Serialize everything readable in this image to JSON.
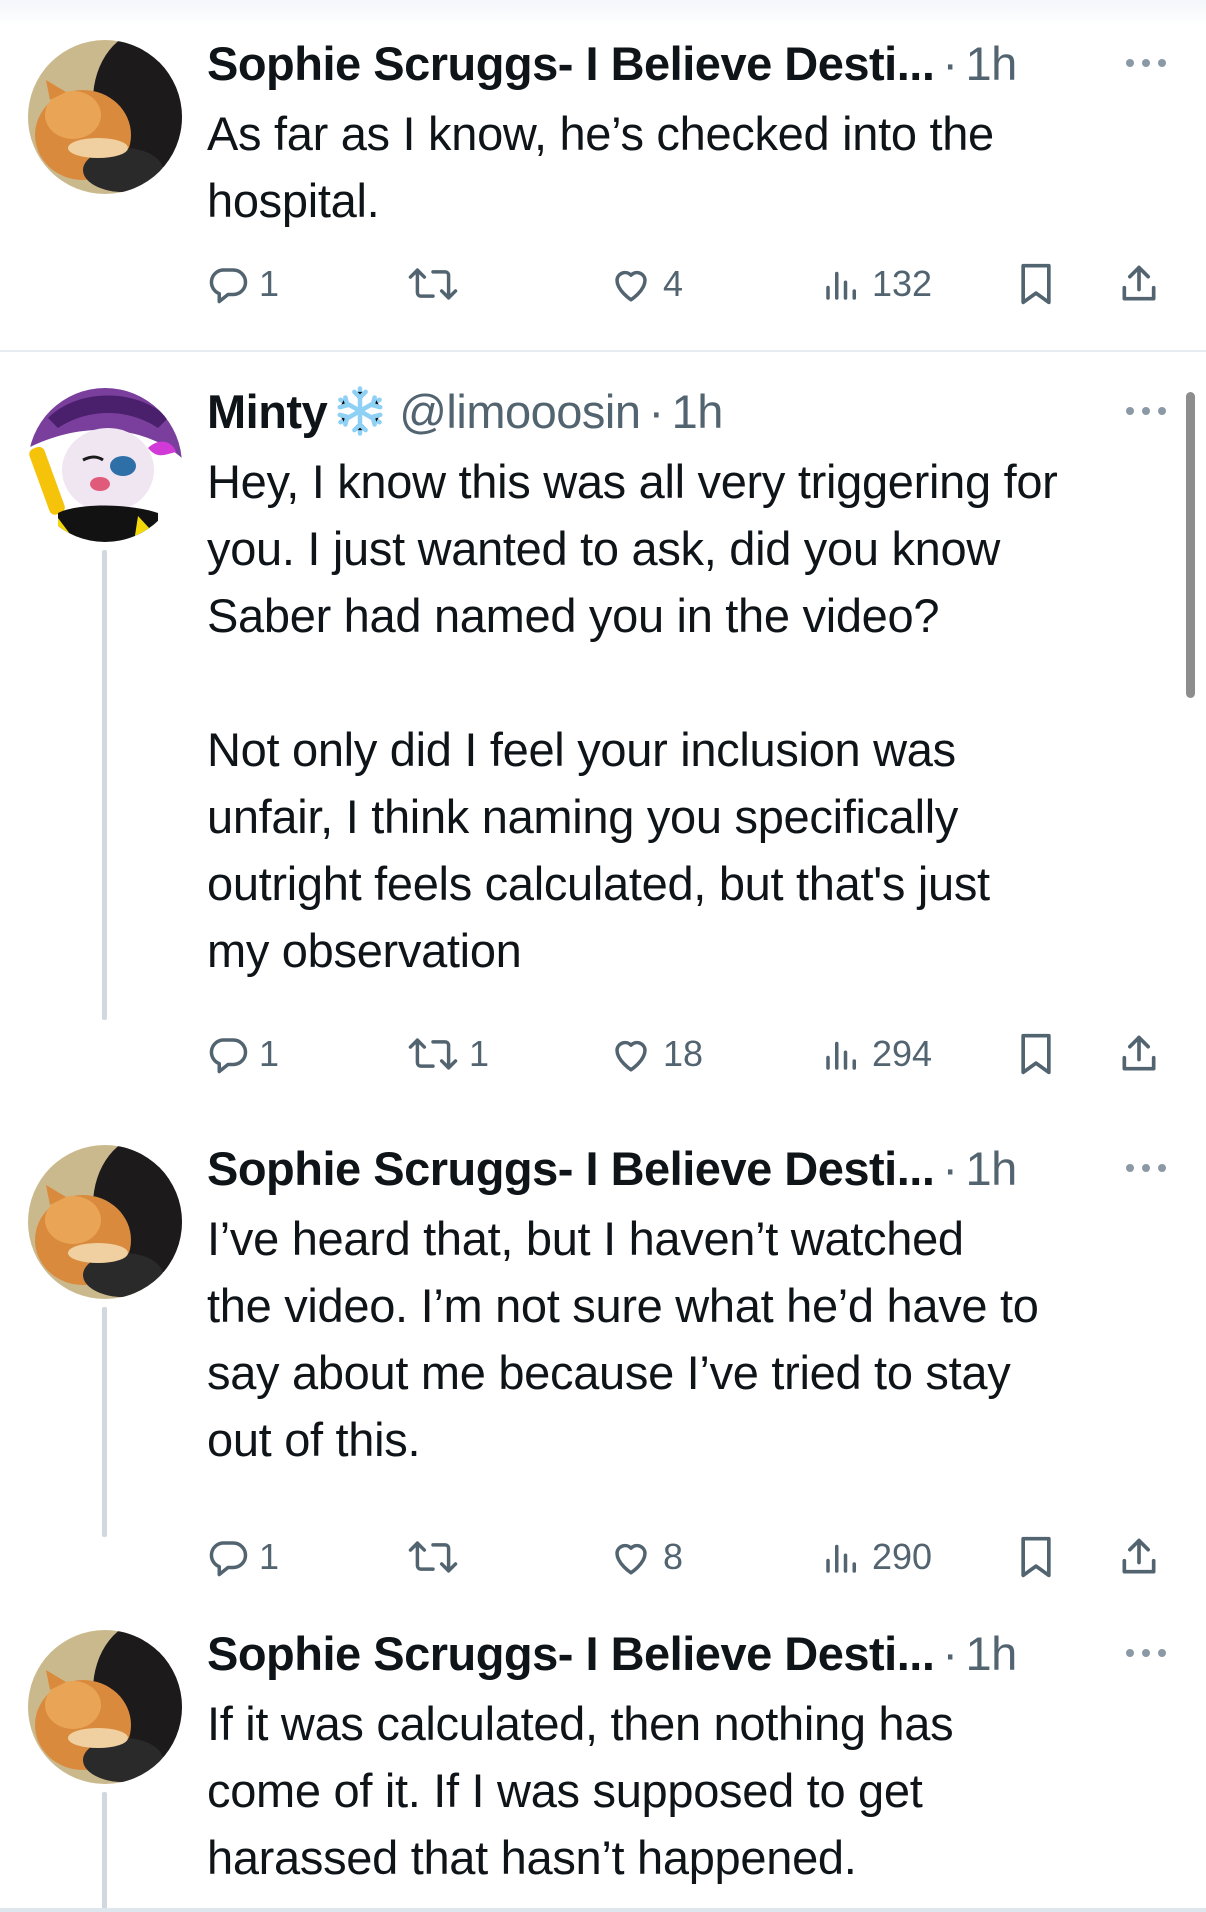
{
  "tweets": [
    {
      "name": "Sophie Scruggs- I Believe Desti...",
      "handle": "",
      "dot": "·",
      "time": "1h",
      "text": "As far as I know, he’s checked into the\nhospital.",
      "replies": "1",
      "retweets": "",
      "likes": "4",
      "views": "132"
    },
    {
      "name": "Minty",
      "handle": "@limooosin",
      "dot": "·",
      "time": "1h",
      "text": "Hey, I know this was all very triggering for\nyou. I just wanted to ask, did you know\nSaber had named you in the video?\n\nNot only did I feel your inclusion was\nunfair, I think naming you specifically\noutright feels calculated, but that's just\nmy observation",
      "replies": "1",
      "retweets": "1",
      "likes": "18",
      "views": "294"
    },
    {
      "name": "Sophie Scruggs- I Believe Desti...",
      "handle": "",
      "dot": "·",
      "time": "1h",
      "text": "I’ve heard that, but I haven’t watched\nthe video. I’m not sure what he’d have to\nsay about me because I’ve tried to stay\nout of this.",
      "replies": "1",
      "retweets": "",
      "likes": "8",
      "views": "290"
    },
    {
      "name": "Sophie Scruggs- I Believe Desti...",
      "handle": "",
      "dot": "·",
      "time": "1h",
      "text": "If it was calculated, then nothing has\ncome of it. If I was supposed to get\nharassed that hasn’t happened.",
      "replies": "",
      "retweets": "",
      "likes": "",
      "views": ""
    }
  ],
  "icons": {
    "reply": "reply-icon",
    "retweet": "retweet-icon",
    "like": "heart-icon",
    "views": "views-icon",
    "bookmark": "bookmark-icon",
    "share": "share-icon",
    "more": "more-icon",
    "badge": "snowflake-icon"
  },
  "colors": {
    "text": "#0f1419",
    "secondary": "#536471",
    "thread_line": "#cfd9de",
    "divider": "#e6ecf0"
  }
}
